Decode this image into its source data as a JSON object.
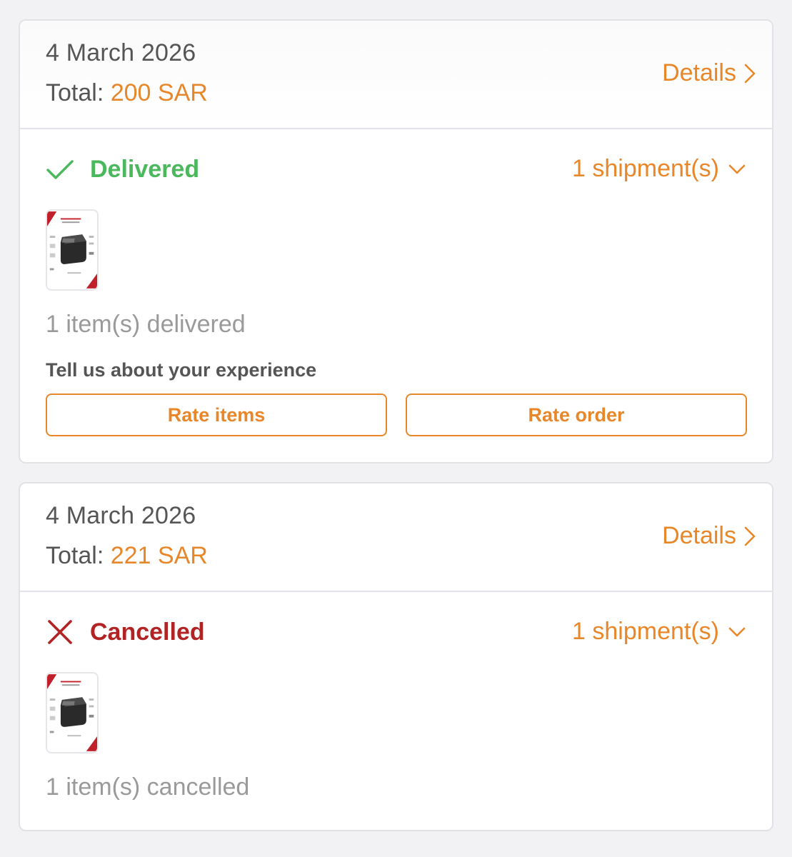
{
  "orders": [
    {
      "date": "4 March 2026",
      "total_label": "Total: ",
      "total_amount": "200 SAR",
      "details_label": "Details",
      "status": "Delivered",
      "shipments_label": "1 shipment(s)",
      "items_text": "1 item(s) delivered",
      "feedback_prompt": "Tell us about your experience",
      "rate_items_label": "Rate items",
      "rate_order_label": "Rate order"
    },
    {
      "date": "4 March 2026",
      "total_label": "Total: ",
      "total_amount": "221 SAR",
      "details_label": "Details",
      "status": "Cancelled",
      "shipments_label": "1 shipment(s)",
      "items_text": "1 item(s) cancelled"
    }
  ],
  "colors": {
    "accent": "#e8872a",
    "delivered": "#4cb85e",
    "cancelled": "#b22323",
    "muted_text": "#9a9a9a",
    "body_text": "#555555"
  },
  "icons": {
    "details": "chevron-right-icon",
    "shipments": "chevron-down-icon",
    "delivered": "checkmark-icon",
    "cancelled": "x-mark-icon"
  }
}
